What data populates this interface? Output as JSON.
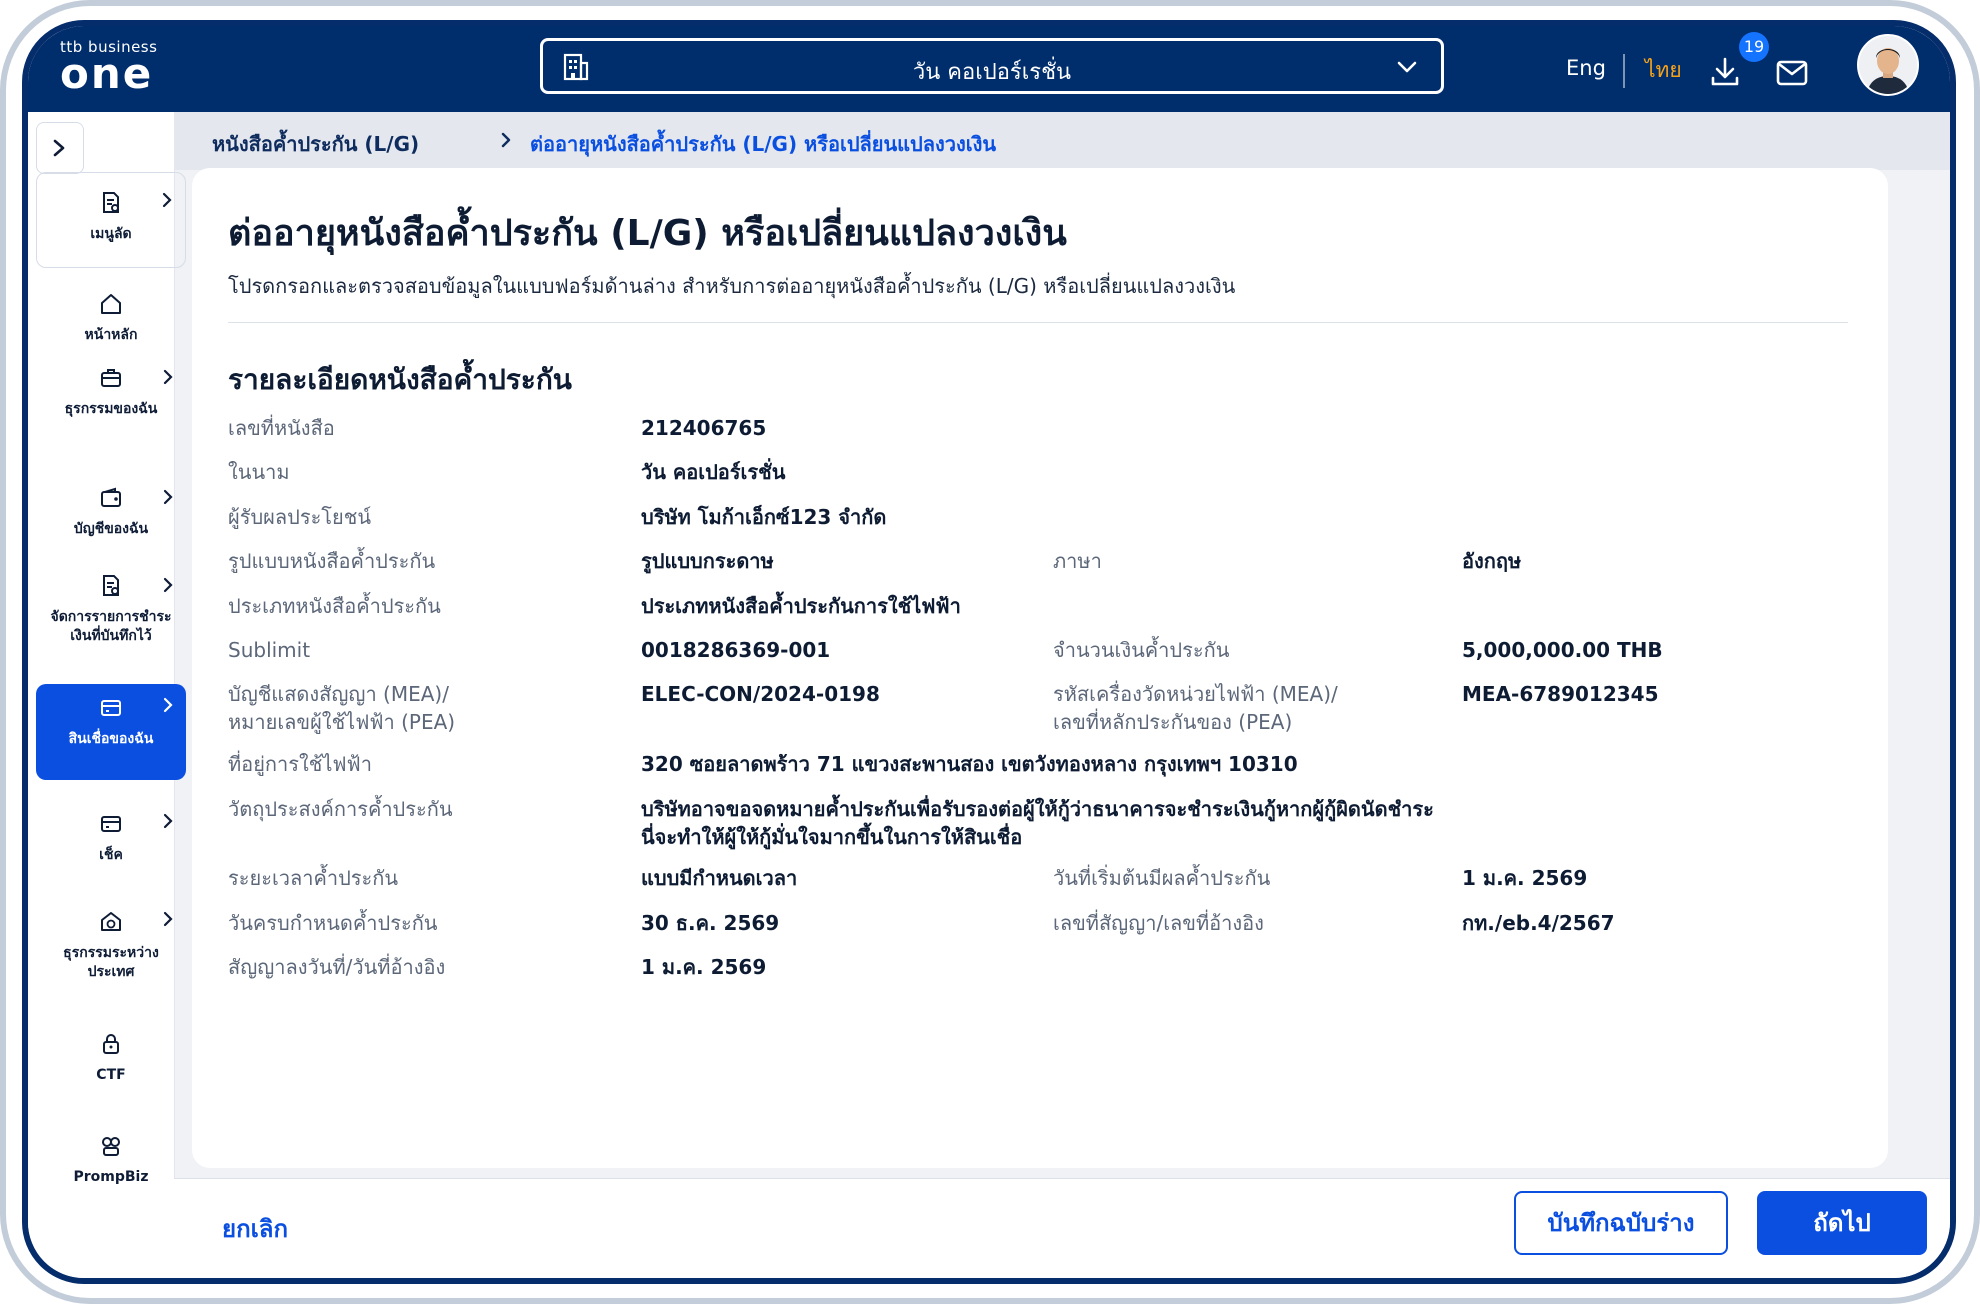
{
  "header": {
    "logo_small": "ttb business",
    "logo_big": "one",
    "company_name": "วัน คอเปอร์เรชั่น",
    "lang_eng": "Eng",
    "lang_thai": "ไทย",
    "download_badge": "19"
  },
  "sidebar": {
    "items": [
      {
        "label": "เมนูลัด",
        "icon": "document-shortcut-icon"
      },
      {
        "label": "หน้าหลัก",
        "icon": "home-icon"
      },
      {
        "label": "ธุรกรรมของฉัน",
        "icon": "briefcase-icon"
      },
      {
        "label": "บัญชีของฉัน",
        "icon": "wallet-icon"
      },
      {
        "label": "จัดการรายการชำระเงินที่บันทึกไว้",
        "icon": "document-edit-icon"
      },
      {
        "label": "สินเชื่อของฉัน",
        "icon": "card-icon"
      },
      {
        "label": "เช็ค",
        "icon": "cheque-icon"
      },
      {
        "label": "ธุรกรรมระหว่างประเทศ",
        "icon": "globe-bank-icon"
      },
      {
        "label": "CTF",
        "icon": "lock-icon"
      },
      {
        "label": "PrompBiz",
        "icon": "prompbiz-icon"
      }
    ]
  },
  "breadcrumb": {
    "parent": "หนังสือค้ำประกัน (L/G)",
    "current": "ต่ออายุหนังสือค้ำประกัน (L/G) หรือเปลี่ยนแปลงวงเงิน"
  },
  "main": {
    "title": "ต่ออายุหนังสือค้ำประกัน (L/G) หรือเปลี่ยนแปลงวงเงิน",
    "subtitle": "โปรดกรอกและตรวจสอบข้อมูลในแบบฟอร์มด้านล่าง สำหรับการต่ออายุหนังสือค้ำประกัน (L/G) หรือเปลี่ยนแปลงวงเงิน",
    "section_title": "รายละเอียดหนังสือค้ำประกัน",
    "fields": {
      "lg_number_label": "เลขที่หนังสือ",
      "lg_number": "212406765",
      "on_behalf_label": "ในนาม",
      "on_behalf": "วัน คอเปอร์เรชั่น",
      "beneficiary_label": "ผู้รับผลประโยชน์",
      "beneficiary": "บริษัท โมก้าเอ็กซ์123 จำกัด",
      "format_label": "รูปแบบหนังสือค้ำประกัน",
      "format": "รูปแบบกระดาษ",
      "language_label": "ภาษา",
      "language": "อังกฤษ",
      "type_label": "ประเภทหนังสือค้ำประกัน",
      "type": "ประเภทหนังสือค้ำประกันการใช้ไฟฟ้า",
      "sublimit_label": "Sublimit",
      "sublimit": "0018286369-001",
      "amount_label": "จำนวนเงินค้ำประกัน",
      "amount": "5,000,000.00 THB",
      "contract_acct_label_1": "บัญชีแสดงสัญญา (MEA)/",
      "contract_acct_label_2": "หมายเลขผู้ใช้ไฟฟ้า (PEA)",
      "contract_acct": "ELEC-CON/2024-0198",
      "meter_label_1": "รหัสเครื่องวัดหน่วยไฟฟ้า (MEA)/",
      "meter_label_2": "เลขที่หลักประกันของ (PEA)",
      "meter": "MEA-6789012345",
      "address_label": "ที่อยู่การใช้ไฟฟ้า",
      "address": "320 ซอยลาดพร้าว 71 แขวงสะพานสอง เขตวังทองหลาง กรุงเทพฯ 10310",
      "purpose_label": "วัตถุประสงค์การค้ำประกัน",
      "purpose_1": "บริษัทอาจขอจดหมายค้ำประกันเพื่อรับรองต่อผู้ให้กู้ว่าธนาคารจะชำระเงินกู้หากผู้กู้ผิดนัดชำระ",
      "purpose_2": "นี่จะทำให้ผู้ให้กู้มั่นใจมากขึ้นในการให้สินเชื่อ",
      "period_label": "ระยะเวลาค้ำประกัน",
      "period": "แบบมีกำหนดเวลา",
      "start_label": "วันที่เริ่มต้นมีผลค้ำประกัน",
      "start": "1 ม.ค. 2569",
      "end_label": "วันครบกำหนดค้ำประกัน",
      "end": "30 ธ.ค. 2569",
      "ref_label": "เลขที่สัญญา/เลขที่อ้างอิง",
      "ref": "กท./eb.4/2567",
      "sign_label": "สัญญาลงวันที่/วันที่อ้างอิง",
      "sign": "1 ม.ค. 2569"
    }
  },
  "footer": {
    "cancel": "ยกเลิก",
    "save_draft": "บันทึกฉบับร่าง",
    "next": "ถัดไป"
  },
  "colors": {
    "navy": "#002d6b",
    "primary_blue": "#0a4fe0",
    "accent_orange": "#f6a319"
  }
}
